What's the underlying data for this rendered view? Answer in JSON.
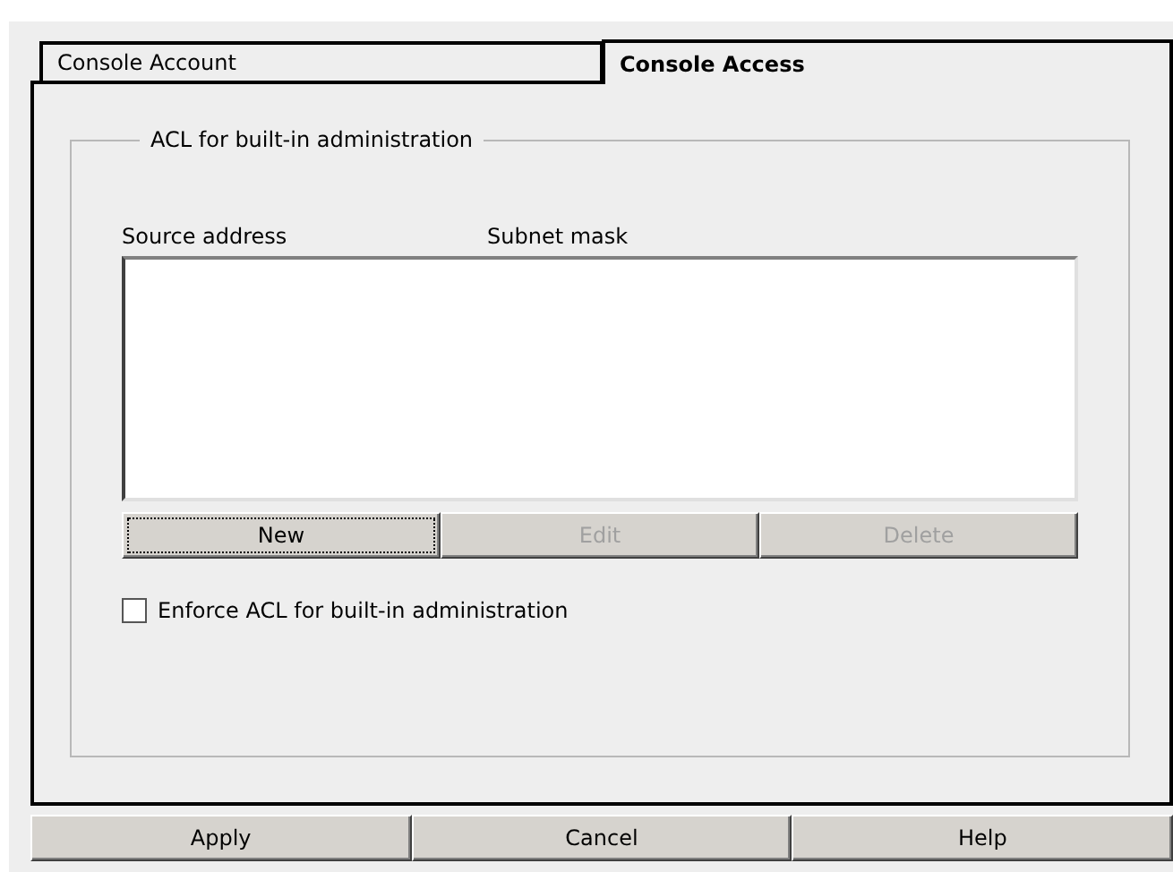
{
  "tabs": [
    {
      "label": "Console Account",
      "selected": false
    },
    {
      "label": "Console Access",
      "selected": true
    }
  ],
  "group": {
    "title": "ACL for built-in administration",
    "list": {
      "columns": [
        "Source address",
        "Subnet mask"
      ]
    },
    "buttons": [
      {
        "label": "New",
        "disabled": false,
        "focused": true
      },
      {
        "label": "Edit",
        "disabled": true,
        "focused": false
      },
      {
        "label": "Delete",
        "disabled": true,
        "focused": false
      }
    ],
    "checkbox": {
      "label": "Enforce ACL for built-in administration",
      "checked": false
    }
  },
  "footer_buttons": [
    "Apply",
    "Cancel",
    "Help"
  ]
}
